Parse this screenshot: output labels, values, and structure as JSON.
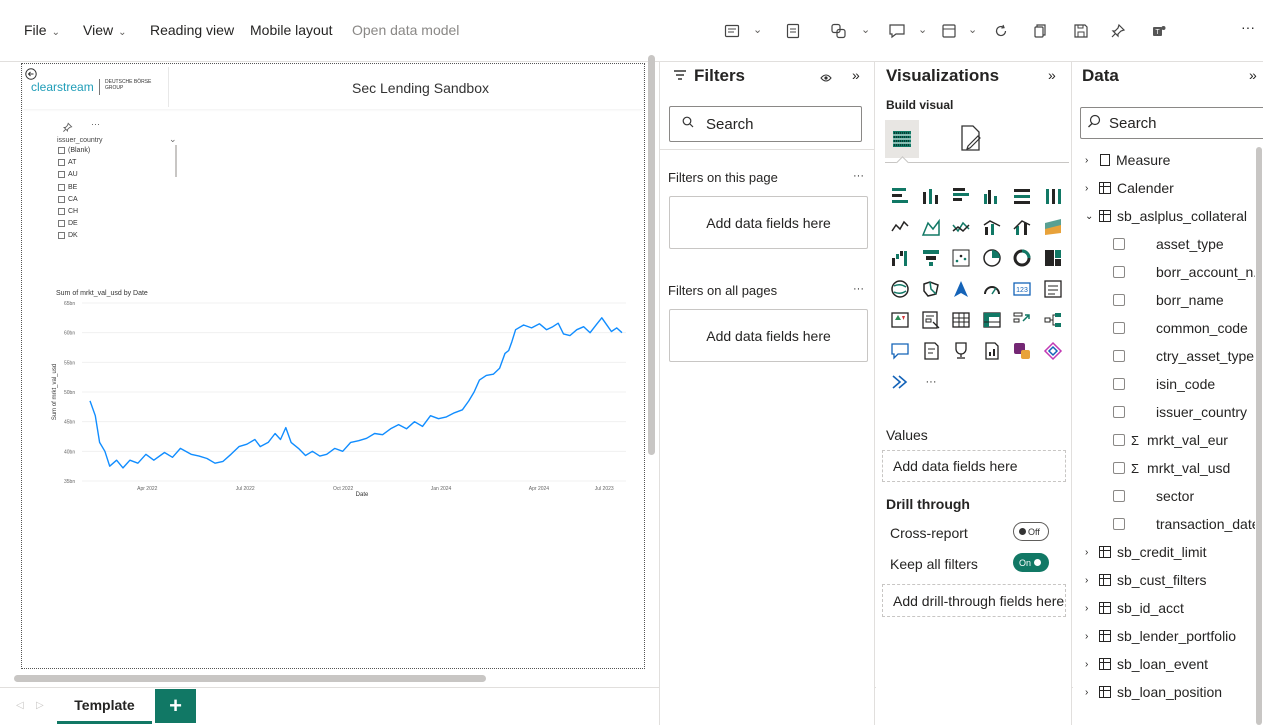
{
  "menu": {
    "file": "File",
    "view": "View",
    "reading_view": "Reading view",
    "mobile_layout": "Mobile layout",
    "open_data_model": "Open data model",
    "more": "···"
  },
  "report": {
    "logo_text": "clearstream",
    "logo_sub1": "DEUTSCHE BÖRSE",
    "logo_sub2": "GROUP",
    "title": "Sec Lending Sandbox",
    "slicer": {
      "more": "···",
      "field": "issuer_country",
      "items": [
        "(Blank)",
        "AT",
        "AU",
        "BE",
        "CA",
        "CH",
        "DE",
        "DK"
      ]
    }
  },
  "chart_data": {
    "type": "line",
    "title": "Sum of mrkt_val_usd by Date",
    "xlabel": "Date",
    "ylabel": "Sum of mrkt_val_usd",
    "y_ticks": [
      "65bn",
      "60bn",
      "55bn",
      "50bn",
      "45bn",
      "40bn",
      "35bn"
    ],
    "x_ticks": [
      "Apr 2022",
      "Jul 2022",
      "Oct 2022",
      "Jan 2024",
      "Apr 2024",
      "Jul 2023"
    ],
    "ylim": [
      35,
      65
    ],
    "series": [
      {
        "color": "#118dff",
        "points": [
          [
            0.0,
            48.5
          ],
          [
            0.01,
            46.0
          ],
          [
            0.018,
            41.5
          ],
          [
            0.028,
            40.0
          ],
          [
            0.037,
            37.5
          ],
          [
            0.05,
            38.5
          ],
          [
            0.062,
            37.2
          ],
          [
            0.075,
            38.5
          ],
          [
            0.09,
            38.0
          ],
          [
            0.105,
            39.5
          ],
          [
            0.12,
            38.5
          ],
          [
            0.14,
            39.8
          ],
          [
            0.155,
            39.0
          ],
          [
            0.17,
            40.5
          ],
          [
            0.19,
            39.5
          ],
          [
            0.205,
            39.2
          ],
          [
            0.22,
            38.8
          ],
          [
            0.235,
            38.0
          ],
          [
            0.25,
            38.3
          ],
          [
            0.265,
            39.5
          ],
          [
            0.28,
            40.8
          ],
          [
            0.295,
            41.2
          ],
          [
            0.31,
            42.0
          ],
          [
            0.32,
            40.8
          ],
          [
            0.335,
            41.5
          ],
          [
            0.348,
            43.0
          ],
          [
            0.358,
            42.0
          ],
          [
            0.368,
            44.0
          ],
          [
            0.378,
            41.5
          ],
          [
            0.392,
            40.5
          ],
          [
            0.405,
            39.3
          ],
          [
            0.418,
            40.0
          ],
          [
            0.432,
            39.2
          ],
          [
            0.445,
            39.5
          ],
          [
            0.46,
            40.5
          ],
          [
            0.475,
            40.0
          ],
          [
            0.49,
            41.5
          ],
          [
            0.505,
            41.8
          ],
          [
            0.52,
            42.2
          ],
          [
            0.535,
            43.0
          ],
          [
            0.55,
            42.8
          ],
          [
            0.565,
            43.8
          ],
          [
            0.58,
            44.5
          ],
          [
            0.595,
            43.8
          ],
          [
            0.61,
            45.0
          ],
          [
            0.625,
            44.2
          ],
          [
            0.64,
            46.0
          ],
          [
            0.655,
            45.5
          ],
          [
            0.67,
            45.8
          ],
          [
            0.685,
            46.5
          ],
          [
            0.7,
            47.0
          ],
          [
            0.712,
            48.5
          ],
          [
            0.722,
            50.0
          ],
          [
            0.732,
            52.0
          ],
          [
            0.745,
            52.8
          ],
          [
            0.758,
            53.0
          ],
          [
            0.77,
            54.0
          ],
          [
            0.78,
            56.5
          ],
          [
            0.787,
            57.0
          ],
          [
            0.793,
            58.5
          ],
          [
            0.8,
            60.5
          ],
          [
            0.815,
            61.3
          ],
          [
            0.83,
            60.8
          ],
          [
            0.845,
            61.5
          ],
          [
            0.858,
            60.5
          ],
          [
            0.87,
            61.0
          ],
          [
            0.88,
            61.6
          ],
          [
            0.89,
            59.8
          ],
          [
            0.902,
            59.5
          ],
          [
            0.915,
            60.5
          ],
          [
            0.928,
            61.0
          ],
          [
            0.94,
            60.0
          ],
          [
            0.952,
            61.4
          ],
          [
            0.962,
            62.5
          ],
          [
            0.97,
            61.5
          ],
          [
            0.98,
            60.2
          ],
          [
            0.99,
            60.8
          ],
          [
            1.0,
            60.0
          ]
        ]
      }
    ]
  },
  "tabs": {
    "template": "Template",
    "add": "+"
  },
  "filters": {
    "title": "Filters",
    "search_placeholder": "Search",
    "on_this_page": "Filters on this page",
    "on_all_pages": "Filters on all pages",
    "add_fields": "Add data fields here",
    "more": "···"
  },
  "visualizations": {
    "title": "Visualizations",
    "build_visual": "Build visual",
    "values_label": "Values",
    "values_placeholder": "Add data fields here",
    "drill_through": "Drill through",
    "cross_report": "Cross-report",
    "cross_report_toggle": "Off",
    "keep_all_filters": "Keep all filters",
    "keep_all_toggle": "On",
    "drill_placeholder": "Add drill-through fields here",
    "more": "···",
    "accent_color": "#117865"
  },
  "data": {
    "title": "Data",
    "search_placeholder": "Search",
    "tables": [
      {
        "name": "Measure",
        "icon": "calculator-icon",
        "expanded": false
      },
      {
        "name": "Calender",
        "icon": "table-icon",
        "expanded": false
      },
      {
        "name": "sb_aslplus_collateral",
        "icon": "table-icon",
        "expanded": true
      }
    ],
    "fields": [
      {
        "name": "asset_type",
        "sigma": false
      },
      {
        "name": "borr_account_n...",
        "sigma": false
      },
      {
        "name": "borr_name",
        "sigma": false
      },
      {
        "name": "common_code",
        "sigma": false
      },
      {
        "name": "ctry_asset_type",
        "sigma": false
      },
      {
        "name": "isin_code",
        "sigma": false
      },
      {
        "name": "issuer_country",
        "sigma": false
      },
      {
        "name": "mrkt_val_eur",
        "sigma": true
      },
      {
        "name": "mrkt_val_usd",
        "sigma": true
      },
      {
        "name": "sector",
        "sigma": false
      },
      {
        "name": "transaction_date",
        "sigma": false
      }
    ],
    "more_tables": [
      "sb_credit_limit",
      "sb_cust_filters",
      "sb_id_acct",
      "sb_lender_portfolio",
      "sb_loan_event",
      "sb_loan_position"
    ]
  }
}
